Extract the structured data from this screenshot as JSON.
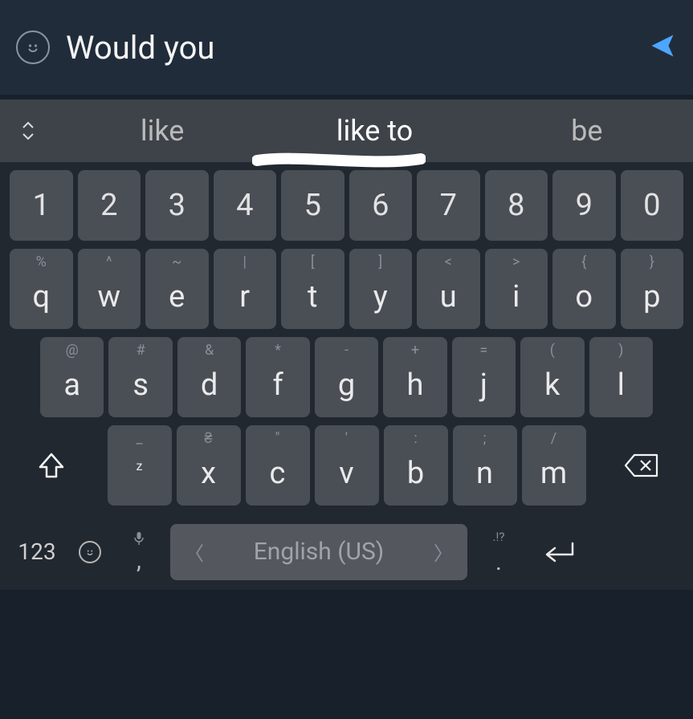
{
  "input": {
    "text": "Would you"
  },
  "suggestions": {
    "left": "like",
    "center": "like to",
    "right": "be"
  },
  "rows": {
    "numbers": [
      "1",
      "2",
      "3",
      "4",
      "5",
      "6",
      "7",
      "8",
      "9",
      "0"
    ],
    "letters1": {
      "alts": [
        "%",
        "^",
        "~",
        "|",
        "[",
        "]",
        "<",
        ">",
        "{",
        "}"
      ],
      "main": [
        "q",
        "w",
        "e",
        "r",
        "t",
        "y",
        "u",
        "i",
        "o",
        "p"
      ]
    },
    "letters2": {
      "alts": [
        "@",
        "#",
        "&",
        "*",
        "-",
        "+",
        "=",
        "(",
        ")"
      ],
      "main": [
        "a",
        "s",
        "d",
        "f",
        "g",
        "h",
        "j",
        "k",
        "l"
      ]
    },
    "letters3": {
      "alts": [
        "_",
        "₴",
        "\"",
        "'",
        ":",
        ";",
        "/"
      ],
      "main": [
        "z",
        "x",
        "c",
        "v",
        "b",
        "n",
        "m"
      ]
    }
  },
  "bottom": {
    "symKey": "123",
    "commaAlt": "mic",
    "comma": ",",
    "spaceLabel": "English (US)",
    "periodAlt": ".!?",
    "period": "."
  }
}
